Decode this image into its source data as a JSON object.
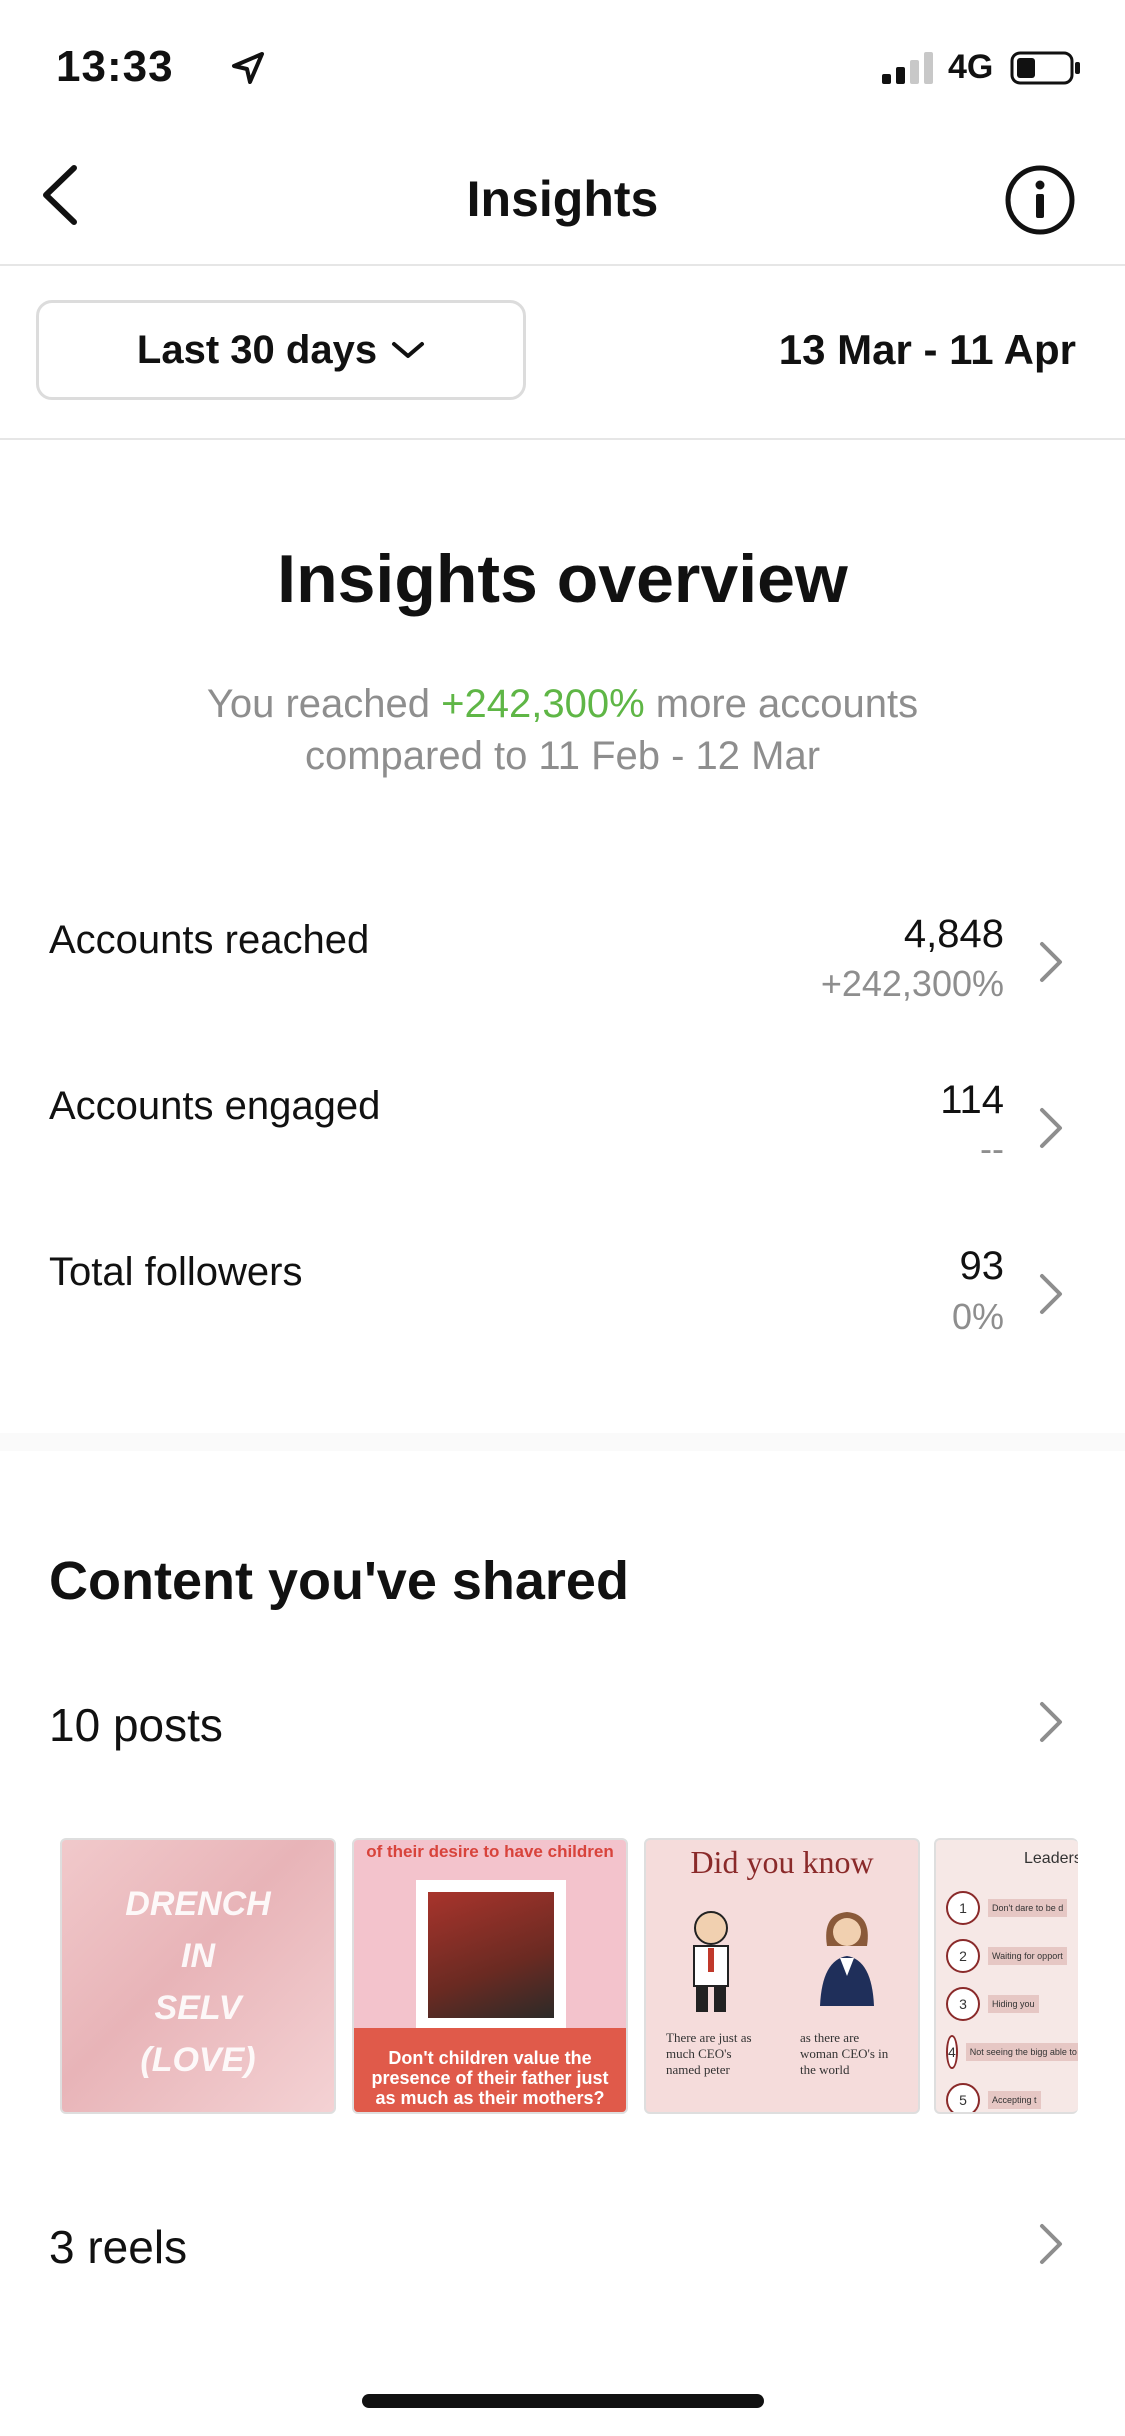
{
  "status_bar": {
    "time": "13:33",
    "network": "4G"
  },
  "nav": {
    "title": "Insights"
  },
  "filter": {
    "range_label": "Last 30 days",
    "date_range": "13 Mar - 11 Apr"
  },
  "overview": {
    "title": "Insights overview",
    "sub_prefix": "You reached ",
    "sub_highlight": "+242,300%",
    "sub_suffix": " more accounts",
    "sub_line2": "compared to 11 Feb - 12 Mar"
  },
  "metrics": [
    {
      "label": "Accounts reached",
      "value": "4,848",
      "delta": "+242,300%"
    },
    {
      "label": "Accounts engaged",
      "value": "114",
      "delta": "--"
    },
    {
      "label": "Total followers",
      "value": "93",
      "delta": "0%"
    }
  ],
  "content": {
    "title": "Content you've shared",
    "posts_label": "10 posts",
    "reels_label": "3 reels",
    "thumbs": [
      {
        "lines": [
          "DRENCH",
          "IN",
          "SELV",
          "(LOVE)"
        ]
      },
      {
        "top": "of their desire to have children",
        "bottom": "Don't children value the presence of their father just as much as their mothers?"
      },
      {
        "title": "Did you know",
        "left_caption": "There are just as much CEO's named peter",
        "right_caption": "as there are woman CEO's in the world"
      },
      {
        "title": "Leaders",
        "items": [
          "Don't dare to be d",
          "Waiting for opport",
          "Hiding you",
          "Not seeing the bigg able to get e",
          "Accepting t"
        ]
      }
    ]
  },
  "colors": {
    "positive": "#5fb646",
    "muted": "#8e8e8e"
  }
}
